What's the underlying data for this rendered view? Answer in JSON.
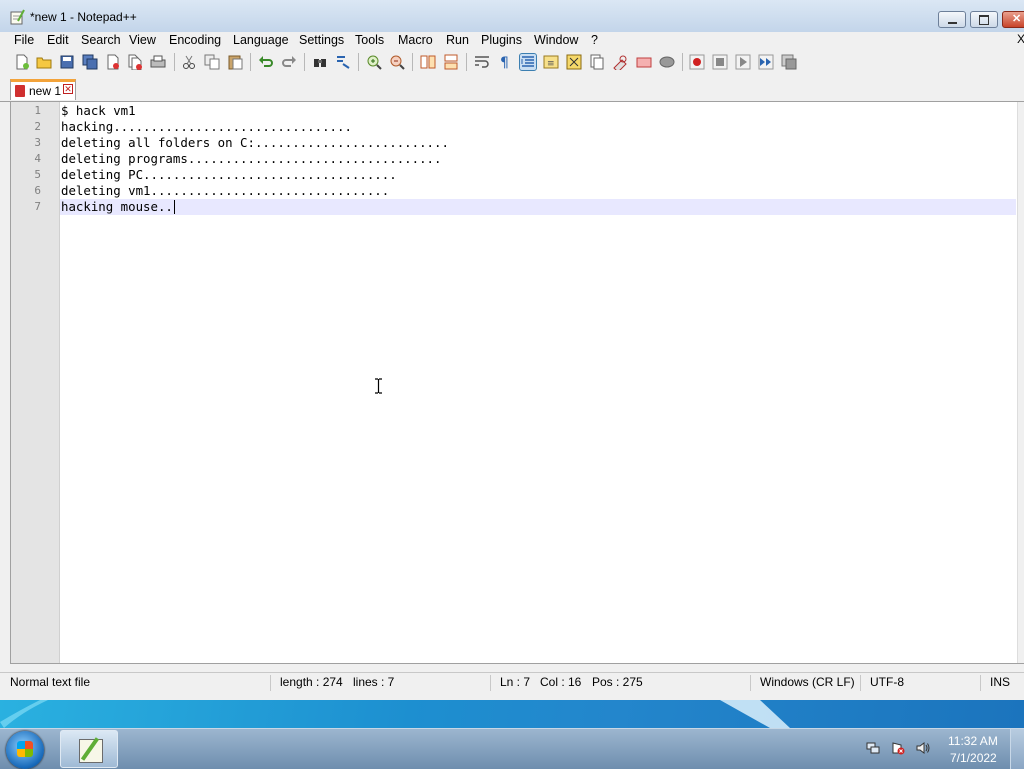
{
  "window": {
    "title": "*new 1 - Notepad++"
  },
  "menu": {
    "items": [
      "File",
      "Edit",
      "Search",
      "View",
      "Encoding",
      "Language",
      "Settings",
      "Tools",
      "Macro",
      "Run",
      "Plugins",
      "Window",
      "?"
    ],
    "close_doc": "X"
  },
  "toolbar": {
    "icons": [
      "new-file-icon",
      "open-file-icon",
      "save-icon",
      "save-all-icon",
      "close-icon",
      "close-all-icon",
      "print-icon",
      "cut-icon",
      "copy-icon",
      "paste-icon",
      "undo-icon",
      "redo-icon",
      "find-icon",
      "replace-icon",
      "zoom-in-icon",
      "zoom-out-icon",
      "sync-vertical-icon",
      "sync-horizontal-icon",
      "word-wrap-icon",
      "show-all-chars-icon",
      "indent-guide-icon",
      "user-language-icon",
      "doc-map-icon",
      "function-list-icon",
      "folder-workspace-icon",
      "monitoring-icon",
      "macro-record-icon",
      "macro-stop-icon",
      "macro-play-icon",
      "macro-run-multiple-icon",
      "macro-save-icon"
    ],
    "active": "indent-guide-icon"
  },
  "tab": {
    "label": "new 1",
    "modified": true
  },
  "editor": {
    "lines": [
      "$ hack vm1",
      "hacking................................",
      "deleting all folders on C:..........................",
      "deleting programs..................................",
      "deleting PC..................................",
      "deleting vm1................................",
      "hacking mouse.."
    ],
    "current_line": 7
  },
  "status": {
    "file_type": "Normal text file",
    "length": "length : 274",
    "lines": "lines : 7",
    "ln": "Ln : 7",
    "col": "Col : 16",
    "pos": "Pos : 275",
    "eol": "Windows (CR LF)",
    "encoding": "UTF-8",
    "mode": "INS"
  },
  "taskbar": {
    "time": "11:32 AM",
    "date": "7/1/2022"
  }
}
